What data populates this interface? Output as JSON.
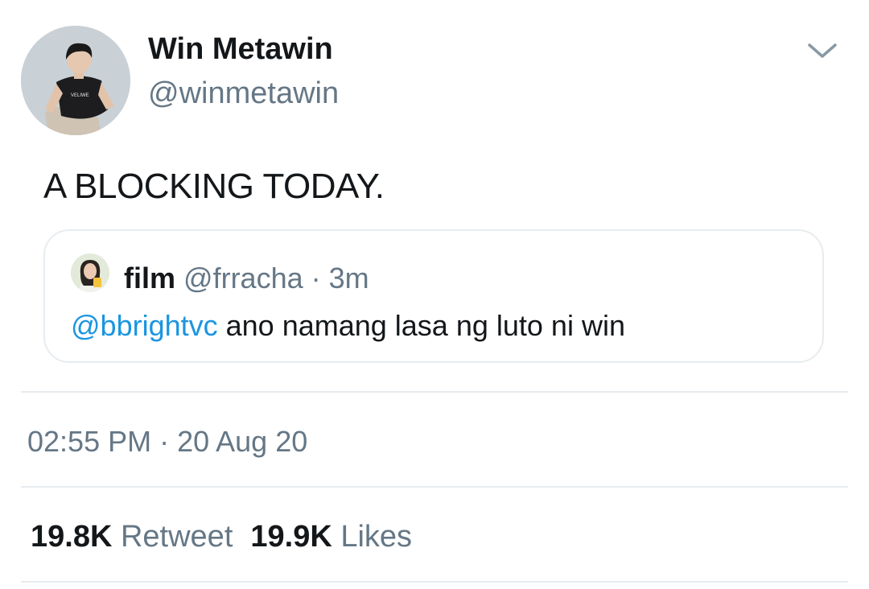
{
  "tweet": {
    "author": {
      "display_name": "Win Metawin",
      "handle": "@winmetawin",
      "avatar_icon": "profile-photo"
    },
    "menu_icon": "chevron-down-icon",
    "text": "A BLOCKING TODAY.",
    "avatar_shirt_text": "VELIWE",
    "quoted": {
      "name": "film",
      "handle": "@frracha",
      "separator": "·",
      "time": "3m",
      "mention": "@bbrightvc",
      "text": " ano namang lasa ng luto ni win"
    },
    "timestamp": "02:55 PM · 20 Aug 20",
    "stats": {
      "retweets_count": "19.8K",
      "retweets_label": "Retweet",
      "likes_count": "19.9K",
      "likes_label": "Likes"
    }
  },
  "colors": {
    "text_primary": "#14171a",
    "text_secondary": "#657786",
    "link": "#1b95e0",
    "border": "#e6ecf0"
  }
}
